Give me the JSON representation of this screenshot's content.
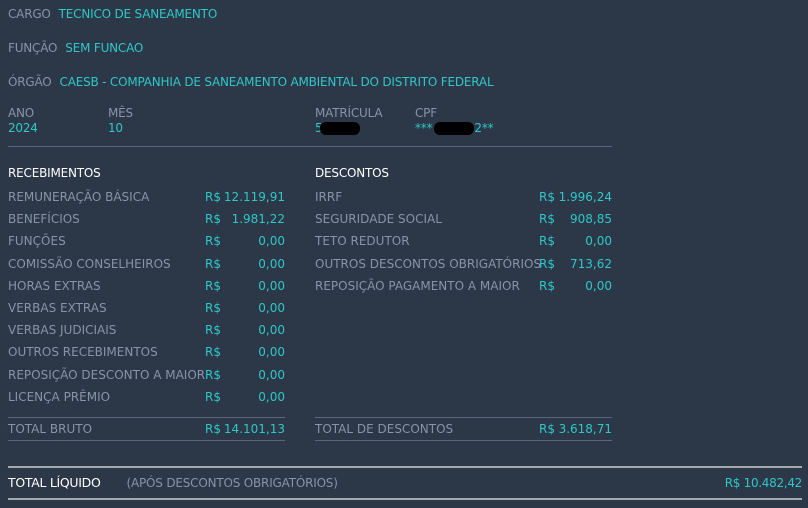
{
  "info": {
    "cargo": {
      "label": "CARGO",
      "value": "TECNICO DE SANEAMENTO"
    },
    "funcao": {
      "label": "FUNÇÃO",
      "value": "SEM FUNCAO"
    },
    "orgao": {
      "label": "ÓRGÃO",
      "value": "CAESB - COMPANHIA DE SANEAMENTO AMBIENTAL DO DISTRITO FEDERAL"
    }
  },
  "meta": {
    "ano": {
      "label": "ANO",
      "value": "2024"
    },
    "mes": {
      "label": "MÊS",
      "value": "10"
    },
    "matricula": {
      "label": "MATRÍCULA",
      "value_prefix": "5",
      "redacted": true
    },
    "cpf": {
      "label": "CPF",
      "value_prefix": "***",
      "value_suffix": "2**",
      "redacted": true
    }
  },
  "currency": "R$",
  "recebimentos": {
    "title": "RECEBIMENTOS",
    "items": [
      {
        "label": "REMUNERAÇÃO BÁSICA",
        "amount": "12.119,91"
      },
      {
        "label": "BENEFÍCIOS",
        "amount": "1.981,22"
      },
      {
        "label": "FUNÇÕES",
        "amount": "0,00"
      },
      {
        "label": "COMISSÃO CONSELHEIROS",
        "amount": "0,00"
      },
      {
        "label": "HORAS EXTRAS",
        "amount": "0,00"
      },
      {
        "label": "VERBAS EXTRAS",
        "amount": "0,00"
      },
      {
        "label": "VERBAS JUDICIAIS",
        "amount": "0,00"
      },
      {
        "label": "OUTROS RECEBIMENTOS",
        "amount": "0,00"
      },
      {
        "label": "REPOSIÇÃO DESCONTO A MAIOR",
        "amount": "0,00"
      },
      {
        "label": "LICENÇA PRÊMIO",
        "amount": "0,00"
      }
    ],
    "total_label": "TOTAL BRUTO",
    "total_amount": "14.101,13"
  },
  "descontos": {
    "title": "DESCONTOS",
    "items": [
      {
        "label": "IRRF",
        "amount": "1.996,24"
      },
      {
        "label": "SEGURIDADE SOCIAL",
        "amount": "908,85"
      },
      {
        "label": "TETO REDUTOR",
        "amount": "0,00"
      },
      {
        "label": "OUTROS DESCONTOS OBRIGATÓRIOS",
        "amount": "713,62"
      },
      {
        "label": "REPOSIÇÃO PAGAMENTO A MAIOR",
        "amount": "0,00"
      }
    ],
    "total_label": "TOTAL DE DESCONTOS",
    "total_amount": "3.618,71"
  },
  "liquido": {
    "title": "TOTAL LÍQUIDO",
    "subtitle": "(APÓS DESCONTOS OBRIGATÓRIOS)",
    "total": "R$ 10.482,42"
  },
  "colors": {
    "background": "#2c3748",
    "label": "#8795a6",
    "value": "#2ec8c8",
    "heading": "#ffffff"
  }
}
